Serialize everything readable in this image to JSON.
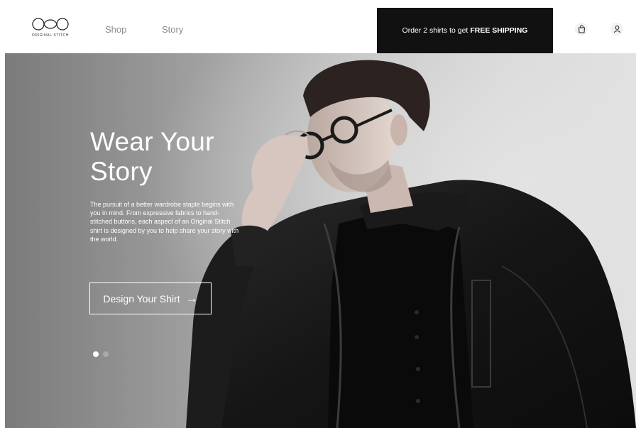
{
  "header": {
    "logo_text": "ORIGINAL STITCH",
    "nav": [
      {
        "label": "Shop"
      },
      {
        "label": "Story"
      }
    ],
    "promo": {
      "prefix": "Order 2 shirts to get",
      "highlight": "FREE SHIPPING"
    },
    "icons": {
      "bag": "shopping-bag-icon",
      "user": "user-icon"
    }
  },
  "hero": {
    "title_line1": "Wear Your",
    "title_line2": "Story",
    "description": "The pursuit of a better wardrobe staple begins with you in mind. From expressive fabrics to hand-stitched buttons, each aspect of an Original Stitch shirt is designed by you to help share your story with the world.",
    "cta_label": "Design Your Shirt",
    "cta_arrow": "→",
    "slides": 2,
    "active_slide": 1
  },
  "colors": {
    "promo_bg": "#111111",
    "accent": "#ffffff",
    "nav_text": "#8a8a8a"
  }
}
